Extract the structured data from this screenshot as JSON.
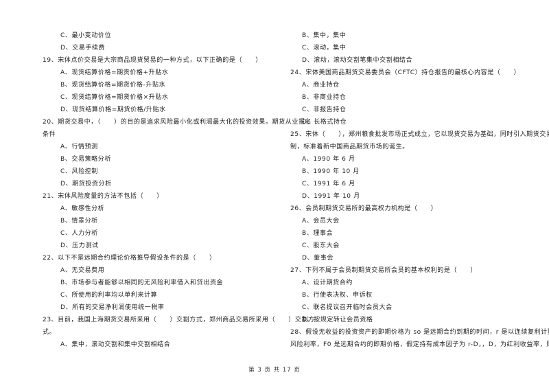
{
  "left_column": [
    {
      "text": "C、最小变动价位",
      "type": "option"
    },
    {
      "text": "D、交易手续费",
      "type": "option"
    },
    {
      "text": "19、宋体点价交易是大宗商品现货贸易的一种方式，以下正确的是（　　）",
      "type": "question"
    },
    {
      "text": "A、现货结算价格=期货价格+升贴水",
      "type": "option"
    },
    {
      "text": "B、现货结算价格=期货价格-升贴水",
      "type": "option"
    },
    {
      "text": "C、现货结算价格=期货价格×升贴水",
      "type": "option"
    },
    {
      "text": "D、现货结算价格=期货价格/升贴水",
      "type": "option"
    },
    {
      "text": "20、期货交易中，（　　）的目的是追求风险最小化或利润最大化的投资效果。期货从业报名",
      "type": "question"
    },
    {
      "text": "条件",
      "type": "question"
    },
    {
      "text": "A、行情预测",
      "type": "option"
    },
    {
      "text": "B、交易策略分析",
      "type": "option"
    },
    {
      "text": "C、风险控制",
      "type": "option"
    },
    {
      "text": "D、期货投资分析",
      "type": "option"
    },
    {
      "text": "21、宋体风险度量的方法不包括（　　）",
      "type": "question"
    },
    {
      "text": "A、敏感性分析",
      "type": "option"
    },
    {
      "text": "B、情景分析",
      "type": "option"
    },
    {
      "text": "C、人力分析",
      "type": "option"
    },
    {
      "text": "D、压力测试",
      "type": "option"
    },
    {
      "text": "22、以下不是远期合约理论价格推导假设条件的是（　　）",
      "type": "question"
    },
    {
      "text": "A、无交易费用",
      "type": "option"
    },
    {
      "text": "B、市场参与者能够以相同的无风险利率借入和贷出资金",
      "type": "option"
    },
    {
      "text": "C、所使用的利率均以单利来计算",
      "type": "option"
    },
    {
      "text": "D、所有的交易净利润使用统一税率",
      "type": "option"
    },
    {
      "text": "23、目前，我国上海期货交易所采用（　　）交割方式，郑州商品交易所采用（　　）交割方",
      "type": "question"
    },
    {
      "text": "式。",
      "type": "question"
    },
    {
      "text": "A、集中，滚动交割和集中交割相结合",
      "type": "option"
    }
  ],
  "right_column": [
    {
      "text": "B、集中，集中",
      "type": "option"
    },
    {
      "text": "C、滚动，集中",
      "type": "option"
    },
    {
      "text": "D、滚动，滚动交割笔集中交割相结合",
      "type": "option"
    },
    {
      "text": "24、宋体美国商品期货交易委员会（CFTC）持仓报告的最核心内容是（　　）",
      "type": "question"
    },
    {
      "text": "A、商业持仓",
      "type": "option"
    },
    {
      "text": "B、非商业持仓",
      "type": "option"
    },
    {
      "text": "C、非报告持仓",
      "type": "option"
    },
    {
      "text": "D、长格式持仓",
      "type": "option"
    },
    {
      "text": "25、宋体（　　），郑州粮食批发市场正式成立，它以现货交易为基础，同时引入期货交易机",
      "type": "question"
    },
    {
      "text": "制，标准着新中国商品期货市场的诞生。",
      "type": "question"
    },
    {
      "text": "A、1990 年 6 月",
      "type": "option"
    },
    {
      "text": "B、1990 年 10 月",
      "type": "option"
    },
    {
      "text": "C、1991 年 6 月",
      "type": "option"
    },
    {
      "text": "D、1991 年 10 月",
      "type": "option"
    },
    {
      "text": "26、会员制期货交易所的最高权力机构是（　　）",
      "type": "question"
    },
    {
      "text": "A、会员大会",
      "type": "option"
    },
    {
      "text": "B、理事会",
      "type": "option"
    },
    {
      "text": "C、股东大会",
      "type": "option"
    },
    {
      "text": "D、董事会",
      "type": "option"
    },
    {
      "text": "27、下列不属于会员制期货交易所会员的基本权利的是（　　）",
      "type": "question"
    },
    {
      "text": "A、设计期货合约",
      "type": "option"
    },
    {
      "text": "B、行使表决权、申诉权",
      "type": "option"
    },
    {
      "text": "C、联名提议召开临时会员大会",
      "type": "option"
    },
    {
      "text": "D、按规定转让会员资格",
      "type": "option"
    },
    {
      "text": "28、假设无收益的投资资产的即期价格为 so 是远期合约到期的时间，r 是以连续复利计算的无",
      "type": "question"
    },
    {
      "text": "风险利率，F0 是远期合约的即期价格，假定持有成本因子为 r-D，，D，为红利收益率，则其",
      "type": "question"
    }
  ],
  "footer": {
    "page_label": "第 3 页 共 17 页"
  }
}
